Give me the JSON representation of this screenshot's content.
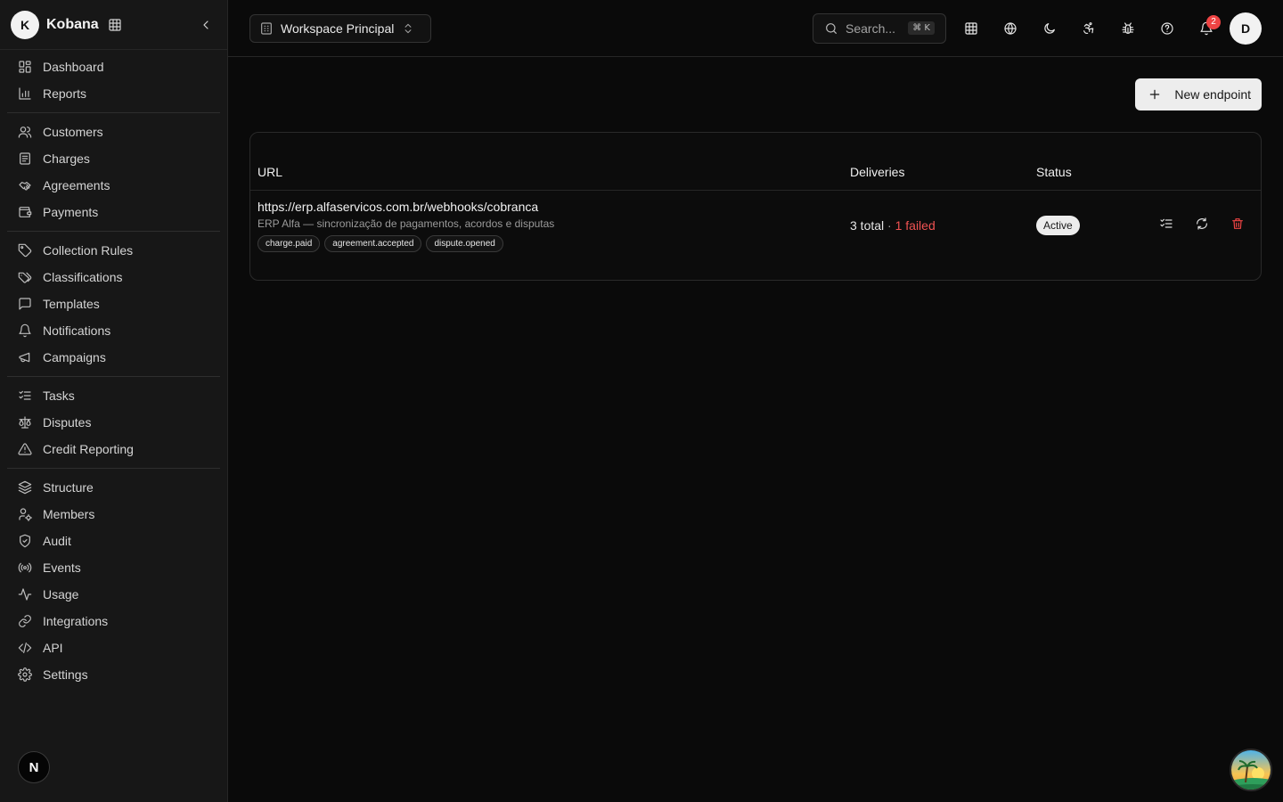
{
  "brand": {
    "initial": "K",
    "name": "Kobana"
  },
  "sidebar": {
    "groups": [
      [
        {
          "label": "Dashboard",
          "icon": "dashboard-icon"
        },
        {
          "label": "Reports",
          "icon": "bar-chart-icon"
        }
      ],
      [
        {
          "label": "Customers",
          "icon": "users-icon"
        },
        {
          "label": "Charges",
          "icon": "receipt-icon"
        },
        {
          "label": "Agreements",
          "icon": "handshake-icon"
        },
        {
          "label": "Payments",
          "icon": "wallet-icon"
        }
      ],
      [
        {
          "label": "Collection Rules",
          "icon": "tag-icon"
        },
        {
          "label": "Classifications",
          "icon": "tags-icon"
        },
        {
          "label": "Templates",
          "icon": "message-square-icon"
        },
        {
          "label": "Notifications",
          "icon": "bell-icon"
        },
        {
          "label": "Campaigns",
          "icon": "megaphone-icon"
        }
      ],
      [
        {
          "label": "Tasks",
          "icon": "list-checks-icon"
        },
        {
          "label": "Disputes",
          "icon": "scale-icon"
        },
        {
          "label": "Credit Reporting",
          "icon": "alert-triangle-icon"
        }
      ],
      [
        {
          "label": "Structure",
          "icon": "layers-icon"
        },
        {
          "label": "Members",
          "icon": "user-cog-icon"
        },
        {
          "label": "Audit",
          "icon": "shield-check-icon"
        },
        {
          "label": "Events",
          "icon": "radio-icon"
        },
        {
          "label": "Usage",
          "icon": "activity-icon"
        },
        {
          "label": "Integrations",
          "icon": "link-icon"
        },
        {
          "label": "API",
          "icon": "code-icon"
        },
        {
          "label": "Settings",
          "icon": "gear-icon"
        }
      ]
    ],
    "footer_logo": "N"
  },
  "topbar": {
    "workspace": "Workspace Principal",
    "search_placeholder": "Search...",
    "search_shortcut": "⌘ K",
    "notifications_count": "2",
    "user_initial": "D"
  },
  "main": {
    "new_endpoint_label": "New endpoint",
    "table": {
      "headers": {
        "url": "URL",
        "deliveries": "Deliveries",
        "status": "Status"
      },
      "rows": [
        {
          "url": "https://erp.alfaservicos.com.br/webhooks/cobranca",
          "description": "ERP Alfa — sincronização de pagamentos, acordos e disputas",
          "events": [
            "charge.paid",
            "agreement.accepted",
            "dispute.opened"
          ],
          "deliveries_total": "3 total",
          "deliveries_sep": " · ",
          "deliveries_failed": "1 failed",
          "status": "Active"
        }
      ]
    }
  },
  "colors": {
    "background": "#0a0a0a",
    "sidebar": "#171717",
    "danger": "#ef4444",
    "badge_bg": "#ececec"
  }
}
